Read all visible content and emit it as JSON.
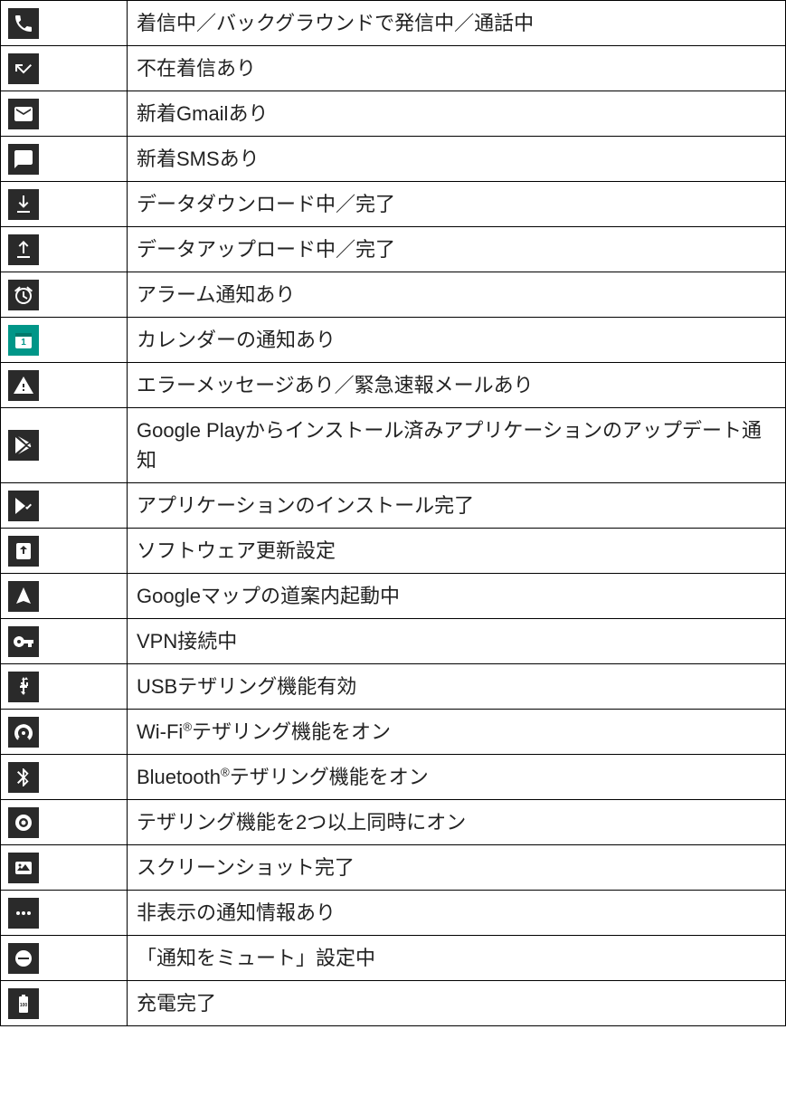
{
  "rows": [
    {
      "icon": "phone-icon",
      "description": "着信中／バックグラウンドで発信中／通話中"
    },
    {
      "icon": "missed-call-icon",
      "description": "不在着信あり"
    },
    {
      "icon": "gmail-icon",
      "description": "新着Gmailあり"
    },
    {
      "icon": "sms-icon",
      "description": "新着SMSあり"
    },
    {
      "icon": "download-icon",
      "description": "データダウンロード中／完了"
    },
    {
      "icon": "upload-icon",
      "description": "データアップロード中／完了"
    },
    {
      "icon": "alarm-icon",
      "description": "アラーム通知あり"
    },
    {
      "icon": "calendar-icon",
      "description": "カレンダーの通知あり"
    },
    {
      "icon": "warning-icon",
      "description": "エラーメッセージあり／緊急速報メールあり"
    },
    {
      "icon": "play-store-icon",
      "description": "Google Playからインストール済みアプリケーションのアップデート通知"
    },
    {
      "icon": "install-complete-icon",
      "description": "アプリケーションのインストール完了"
    },
    {
      "icon": "software-update-icon",
      "description": "ソフトウェア更新設定"
    },
    {
      "icon": "navigation-icon",
      "description": "Googleマップの道案内起動中"
    },
    {
      "icon": "vpn-key-icon",
      "description": "VPN接続中"
    },
    {
      "icon": "usb-tethering-icon",
      "description": "USBテザリング機能有効"
    },
    {
      "icon": "wifi-tethering-icon",
      "description": "Wi-Fi®テザリング機能をオン"
    },
    {
      "icon": "bluetooth-tethering-icon",
      "description": "Bluetooth®テザリング機能をオン"
    },
    {
      "icon": "multi-tethering-icon",
      "description": "テザリング機能を2つ以上同時にオン"
    },
    {
      "icon": "screenshot-icon",
      "description": "スクリーンショット完了"
    },
    {
      "icon": "hidden-notification-icon",
      "description": "非表示の通知情報あり"
    },
    {
      "icon": "mute-notification-icon",
      "description": "「通知をミュート」設定中"
    },
    {
      "icon": "battery-full-icon",
      "description": "充電完了"
    }
  ],
  "icon_styles": {
    "calendar-icon": {
      "bg": "#009688"
    }
  }
}
